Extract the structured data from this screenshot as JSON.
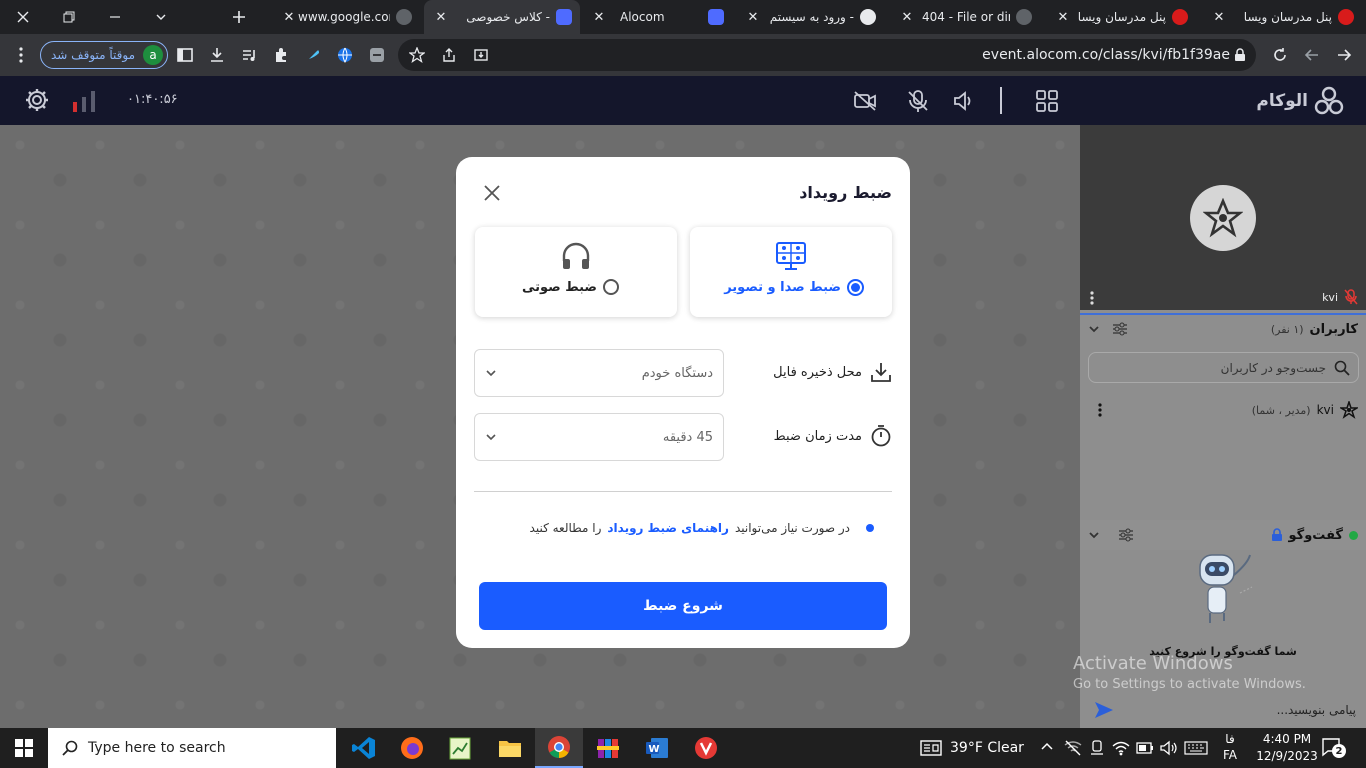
{
  "browser": {
    "tabs": [
      {
        "title": "www.google.com"
      },
      {
        "title": "کلاس خصوصی -"
      },
      {
        "title": "Alocom"
      },
      {
        "title": "ورود به سیستم -"
      },
      {
        "title": "404 - File or dire"
      },
      {
        "title": "پنل مدرسان ویسا"
      },
      {
        "title": "پنل مدرسان ویسا"
      }
    ],
    "url": "event.alocom.co/class/kvi/fb1f39ae",
    "profile_initial": "a",
    "paused_label": "موقتاً متوقف شد"
  },
  "app": {
    "brand": "الوکام",
    "timer": "۰۱:۴۰:۵۶"
  },
  "modal": {
    "title": "ضبط رویداد",
    "option_av": "ضبط صدا و تصویر",
    "option_audio": "ضبط صوتی",
    "save_label": "محل ذخیره فایل",
    "save_value": "دستگاه خودم",
    "duration_label": "مدت زمان ضبط",
    "duration_value": "45 دقیقه",
    "info_pre": "در صورت نیاز می‌توانید",
    "info_link": "راهنمای ضبط رویداد",
    "info_post": "را مطالعه کنید",
    "start_button": "شروع ضبط"
  },
  "panel": {
    "video_name": "kvi",
    "users_title": "کاربران",
    "users_count": "(۱ نفر)",
    "search_placeholder": "جست‌وجو در کاربران",
    "user_name": "kvi",
    "user_role": "(مدیر ، شما)",
    "chat_title": "گفت‌وگو",
    "chat_empty": "شما گفت‌وگو را شروع کنید",
    "chat_placeholder": "پیامی بنویسید..."
  },
  "watermark": {
    "line1": "Activate Windows",
    "line2": "Go to Settings to activate Windows."
  },
  "taskbar": {
    "search": "Type here to search",
    "weather": "39°F  Clear",
    "lang_top": "فا",
    "lang_bottom": "FA",
    "time": "4:40 PM",
    "date": "12/9/2023",
    "notif_count": "2"
  },
  "colors": {
    "accent": "#1a5cff",
    "header": "#14162b"
  }
}
